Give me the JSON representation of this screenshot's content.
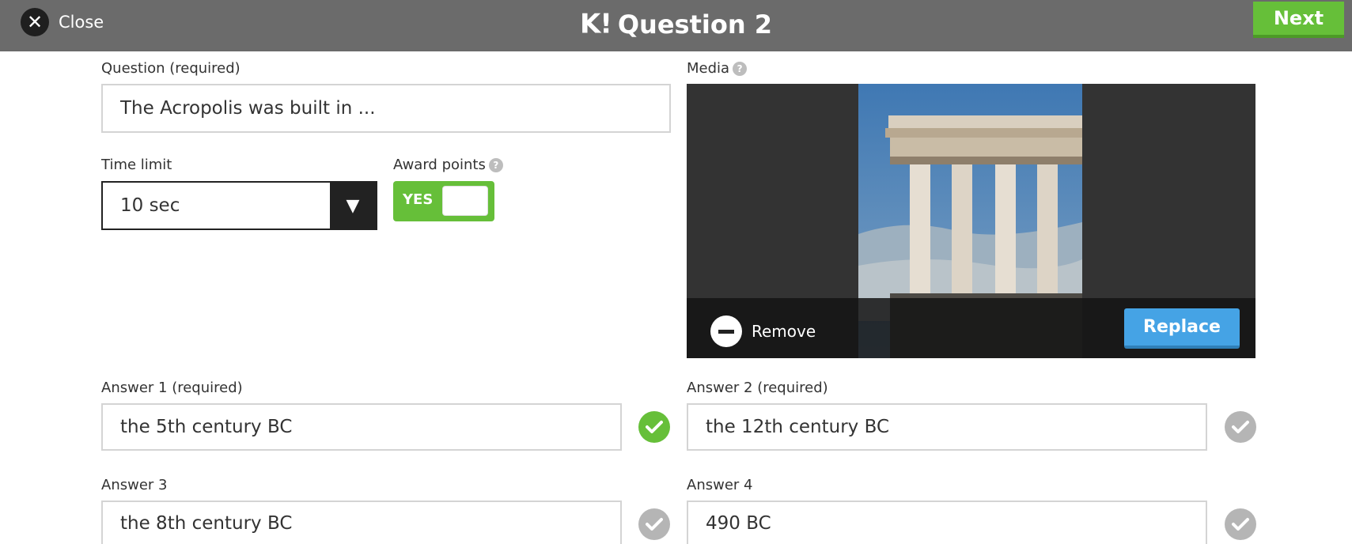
{
  "header": {
    "close_label": "Close",
    "logo": "K!",
    "title": "Question 2",
    "next_label": "Next"
  },
  "question": {
    "label": "Question (required)",
    "value": "The Acropolis was built in ..."
  },
  "time_limit": {
    "label": "Time limit",
    "value": "10 sec"
  },
  "award_points": {
    "label": "Award points",
    "toggle_label": "YES",
    "enabled": true
  },
  "media": {
    "label": "Media",
    "remove_label": "Remove",
    "replace_label": "Replace"
  },
  "answers": [
    {
      "label": "Answer 1 (required)",
      "value": "the 5th century BC",
      "correct": true
    },
    {
      "label": "Answer 2 (required)",
      "value": "the 12th century BC",
      "correct": false
    },
    {
      "label": "Answer 3",
      "value": "the 8th century BC",
      "correct": false
    },
    {
      "label": "Answer 4",
      "value": "490 BC",
      "correct": false
    }
  ],
  "colors": {
    "header_bg": "#6b6b6b",
    "green": "#66bf39",
    "blue": "#45a3e5",
    "check_off": "#b5b5b5"
  },
  "icons": {
    "close": "close-icon",
    "help": "help-icon",
    "dropdown": "triangle-down-icon",
    "remove": "minus-circle-icon",
    "check": "check-icon"
  }
}
